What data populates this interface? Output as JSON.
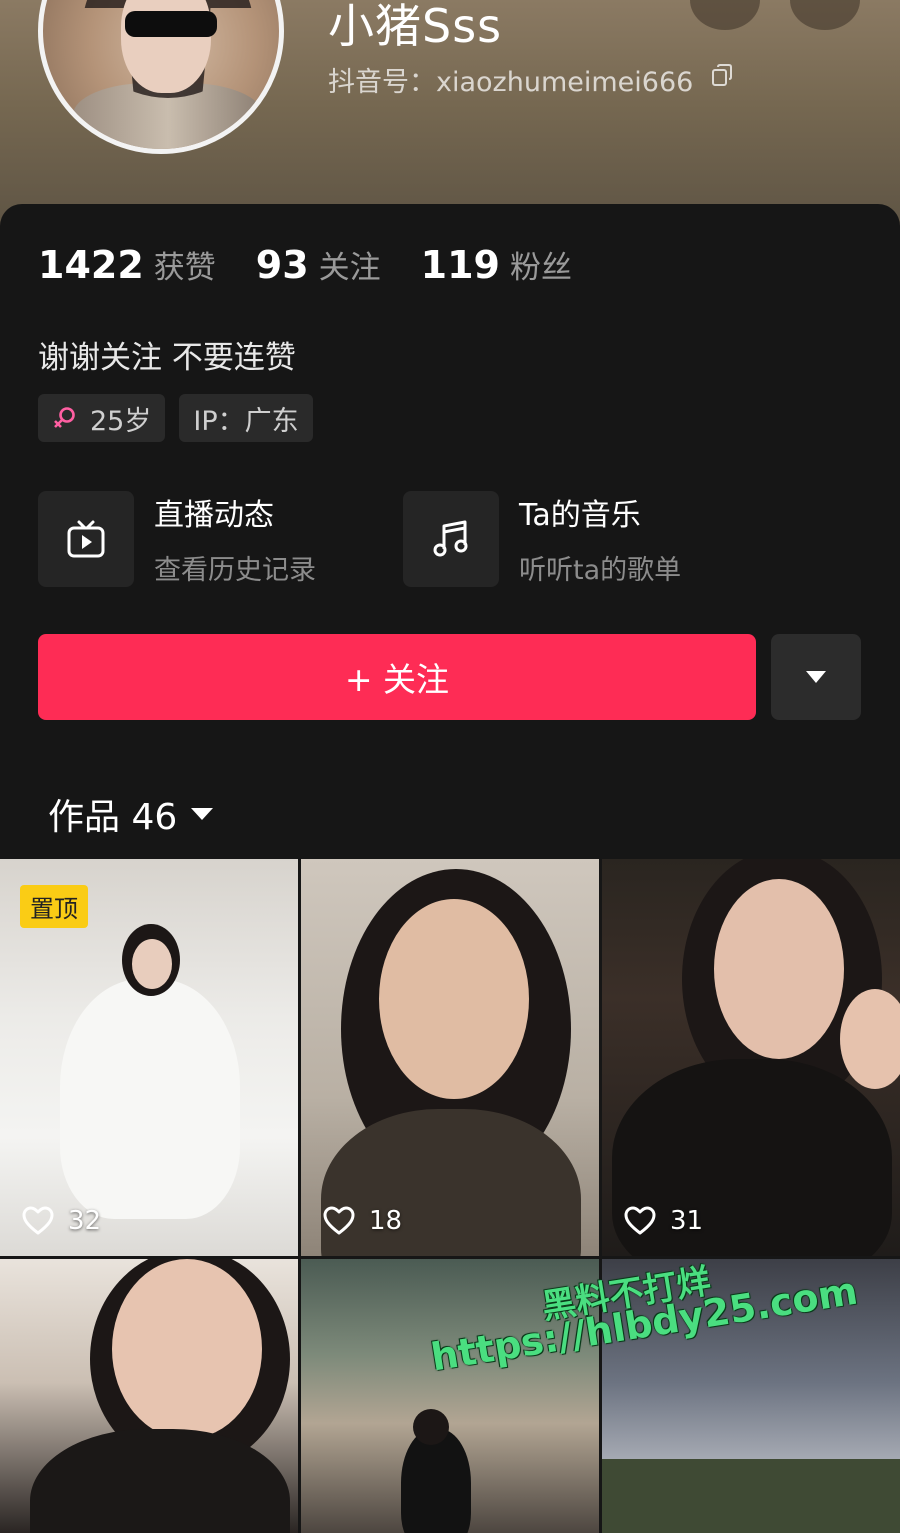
{
  "profile": {
    "nickname": "小猪Sss",
    "douyin_id": "抖音号：xiaozhumeimei666"
  },
  "stats": [
    {
      "value": "1422",
      "label": "获赞"
    },
    {
      "value": "93",
      "label": "关注"
    },
    {
      "value": "119",
      "label": "粉丝"
    }
  ],
  "bio": "谢谢关注 不要连赞",
  "tags": {
    "gender_icon": "female-symbol-icon",
    "age": "25岁",
    "ip": "IP：广东"
  },
  "entries": [
    {
      "icon": "tv-play-icon",
      "title": "直播动态",
      "subtitle": "查看历史记录"
    },
    {
      "icon": "music-note-icon",
      "title": "Ta的音乐",
      "subtitle": "听听ta的歌单"
    }
  ],
  "follow_button": "+ 关注",
  "works": {
    "label": "作品 46"
  },
  "grid": [
    {
      "likes": "32",
      "pinned_label": "置顶"
    },
    {
      "likes": "18"
    },
    {
      "likes": "31"
    },
    {
      "likes": null
    },
    {
      "likes": null
    },
    {
      "likes": null
    }
  ],
  "watermark": {
    "line1": "黑料不打烊",
    "line2": "https://hlbdy25.com"
  },
  "colors": {
    "accent": "#fe2c55",
    "pin_badge": "#facc15",
    "watermark": "#4ade80",
    "background": "#161616"
  }
}
